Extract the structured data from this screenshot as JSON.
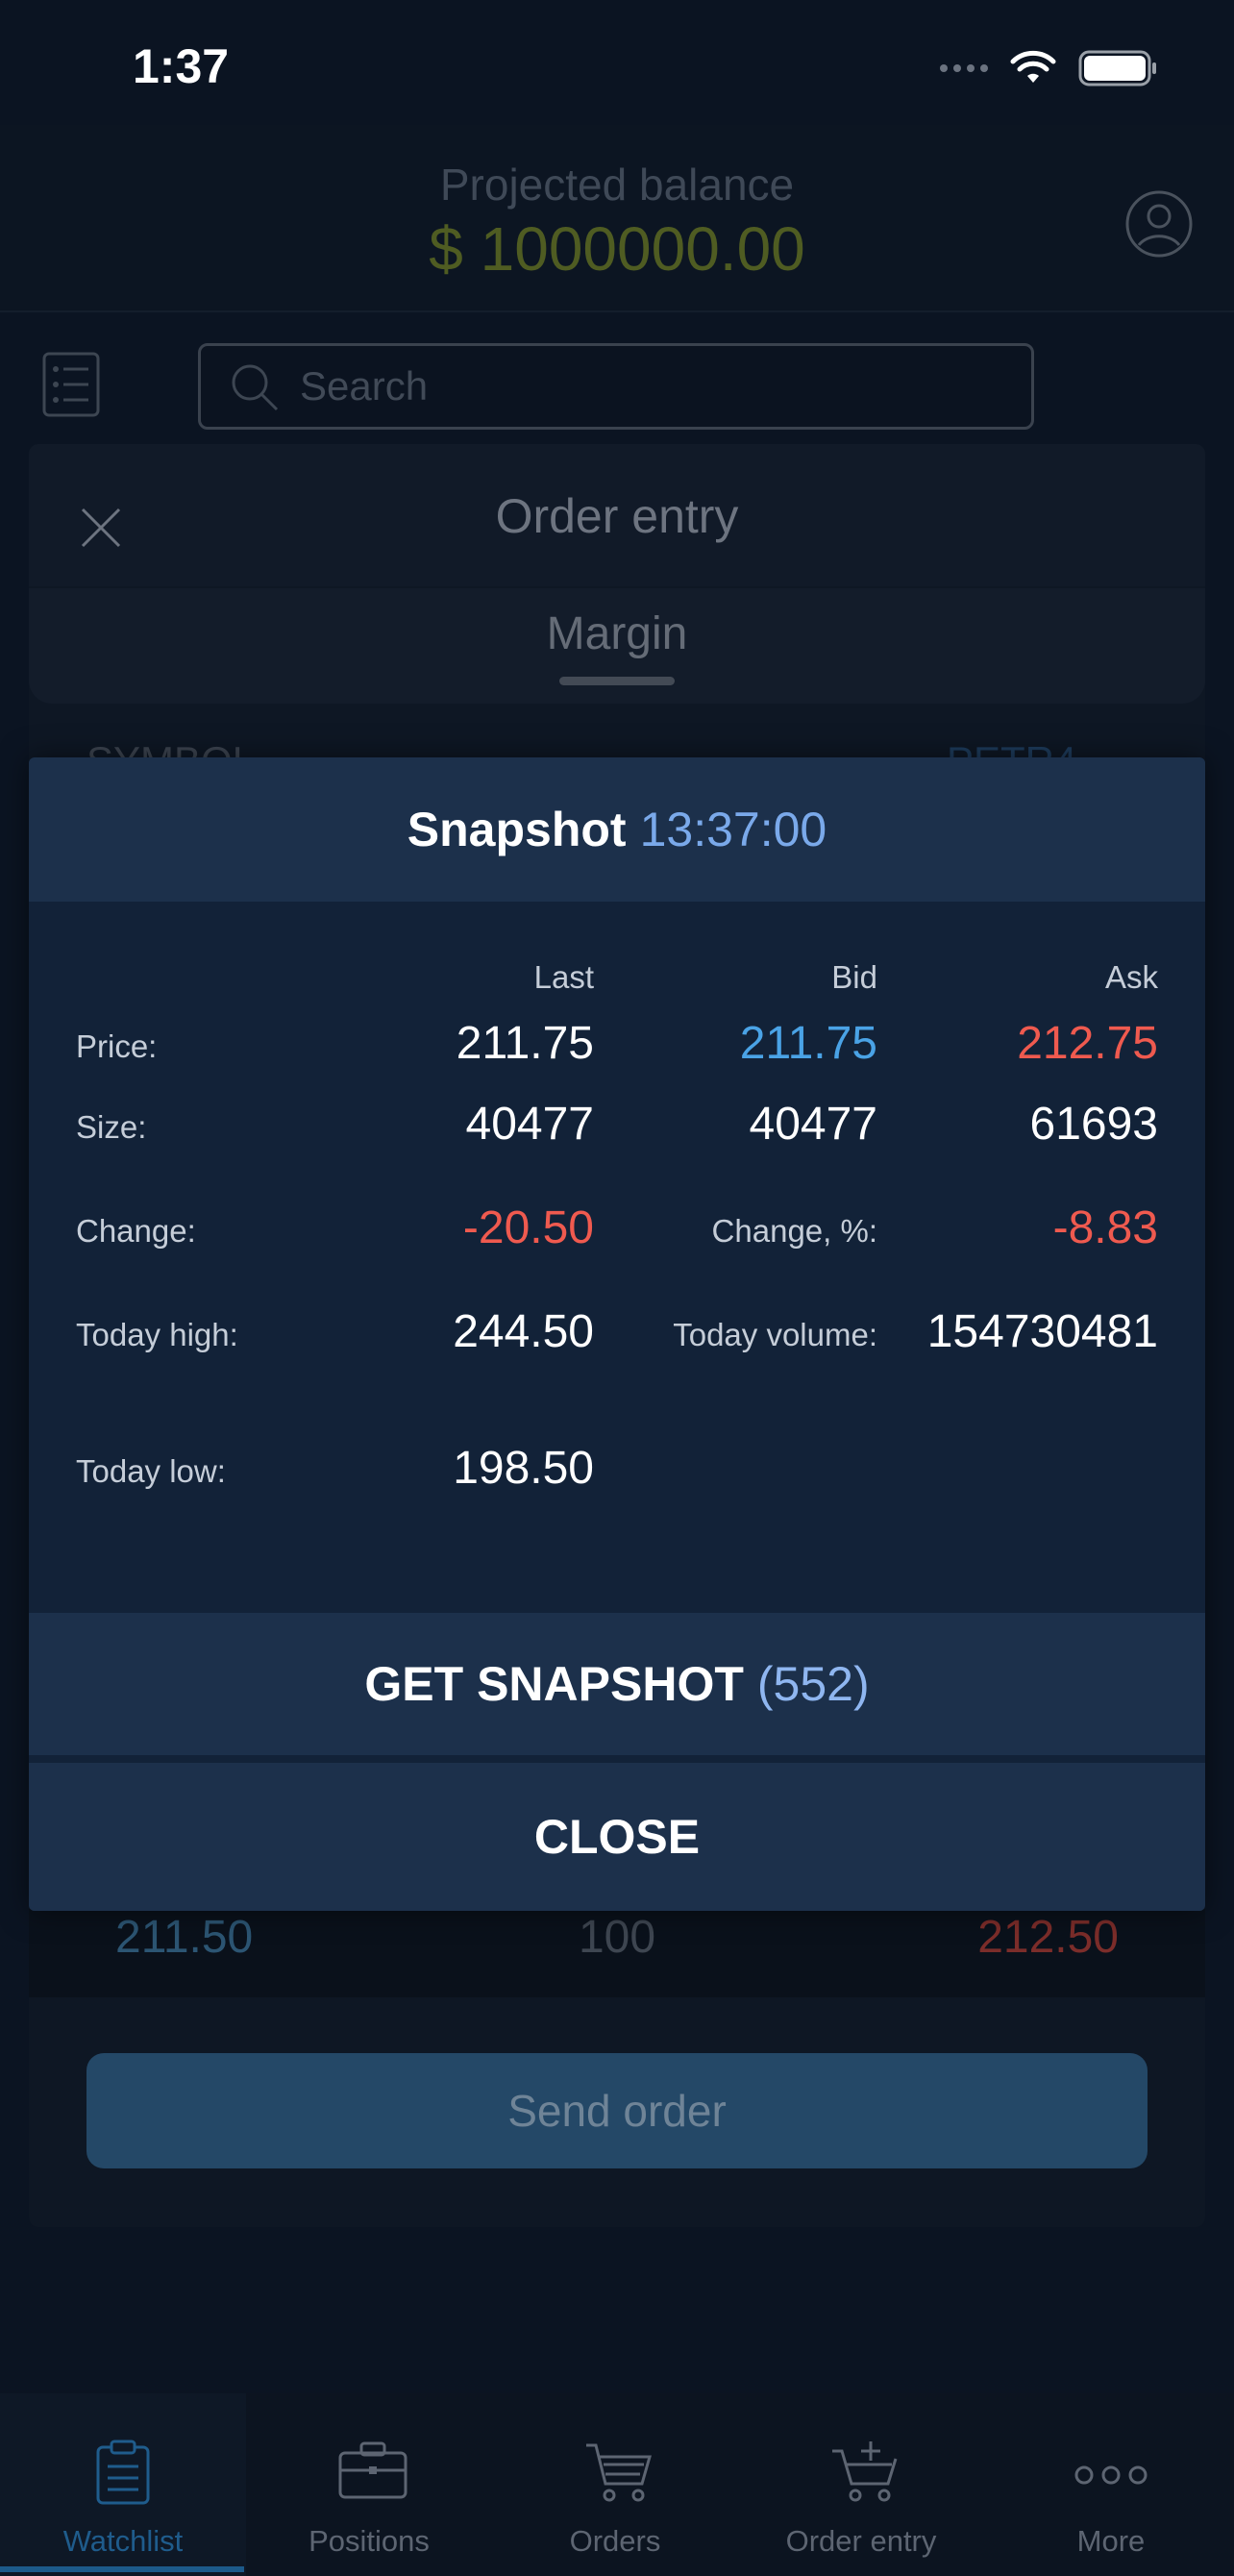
{
  "status_bar": {
    "time": "1:37"
  },
  "header": {
    "balance_label": "Projected balance",
    "balance_value": "$ 1000000.00"
  },
  "search": {
    "placeholder": "Search"
  },
  "order_entry": {
    "title": "Order entry",
    "account_type": "Margin",
    "symbol_label": "SYMBOL",
    "symbol_value": "PETR4",
    "quote_row": {
      "bid": "211.50",
      "size": "100",
      "ask": "212.50"
    },
    "send_button": "Send order"
  },
  "snapshot": {
    "title": "Snapshot",
    "time": "13:37:00",
    "columns": {
      "last": "Last",
      "bid": "Bid",
      "ask": "Ask"
    },
    "price": {
      "label": "Price:",
      "last": "211.75",
      "bid": "211.75",
      "ask": "212.75"
    },
    "size": {
      "label": "Size:",
      "last": "40477",
      "bid": "40477",
      "ask": "61693"
    },
    "change": {
      "label": "Change:",
      "value": "-20.50"
    },
    "change_pct": {
      "label": "Change, %:",
      "value": "-8.83"
    },
    "today_high": {
      "label": "Today high:",
      "value": "244.50"
    },
    "today_volume": {
      "label": "Today volume:",
      "value": "154730481"
    },
    "today_low": {
      "label": "Today low:",
      "value": "198.50"
    },
    "get_button": "GET SNAPSHOT",
    "get_count": "(552)",
    "close_button": "CLOSE"
  },
  "tabs": [
    {
      "label": "Watchlist",
      "icon": "clipboard-icon",
      "active": true
    },
    {
      "label": "Positions",
      "icon": "briefcase-icon",
      "active": false
    },
    {
      "label": "Orders",
      "icon": "cart-icon",
      "active": false
    },
    {
      "label": "Order entry",
      "icon": "cart-plus-icon",
      "active": false
    },
    {
      "label": "More",
      "icon": "more-dots-icon",
      "active": false
    }
  ],
  "colors": {
    "accent_blue": "#4aa3e6",
    "negative_red": "#ef5a4f",
    "modal_header": "#1c304b",
    "balance_green": "#4f5c22"
  }
}
